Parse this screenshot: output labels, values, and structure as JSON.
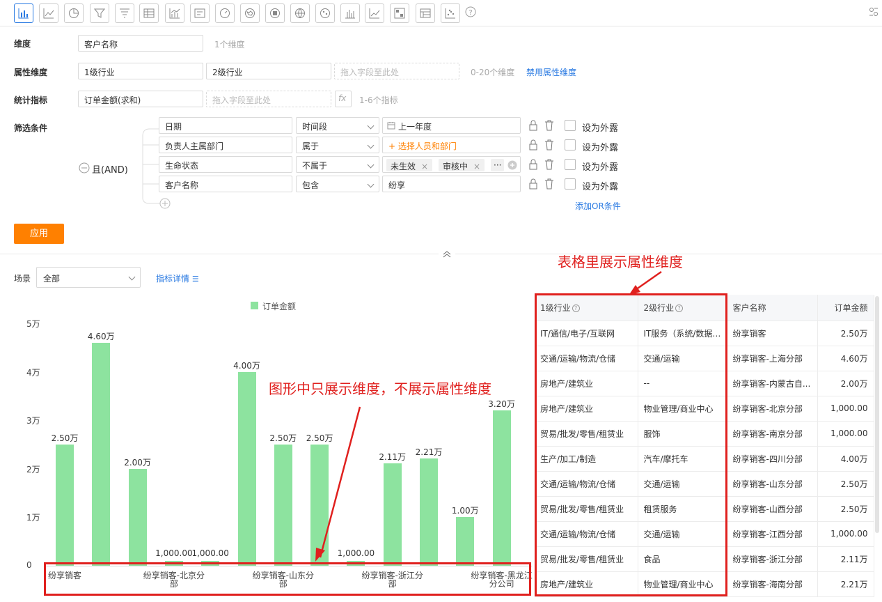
{
  "form": {
    "dimension_label": "维度",
    "dimension_value": "客户名称",
    "dimension_hint": "1个维度",
    "attr_label": "属性维度",
    "attr_values": [
      "1级行业",
      "2级行业"
    ],
    "drop_placeholder": "拖入字段至此处",
    "attr_hint": "0-20个维度",
    "disable_attr_link": "禁用属性维度",
    "metric_label": "统计指标",
    "metric_value": "订单金额(求和)",
    "fx_label": "fx",
    "metric_hint": "1-6个指标",
    "filter_label": "筛选条件",
    "and_label": "且(AND)",
    "filters": [
      {
        "field": "日期",
        "op": "时间段",
        "value": "上一年度"
      },
      {
        "field": "负责人主属部门",
        "op": "属于",
        "value": "+ 选择人员和部门"
      },
      {
        "field": "生命状态",
        "op": "不属于",
        "tags": [
          "未生效",
          "审核中"
        ],
        "more": "···"
      },
      {
        "field": "客户名称",
        "op": "包含",
        "value": "纷享"
      }
    ],
    "expose_label": "设为外露",
    "add_or_link": "添加OR条件",
    "apply_button": "应用"
  },
  "scene": {
    "label": "场景",
    "value": "全部",
    "detail_link": "指标详情"
  },
  "chart_data": {
    "type": "bar",
    "legend": [
      "订单金额"
    ],
    "y_ticks": [
      "5万",
      "4万",
      "3万",
      "2万",
      "1万",
      "0"
    ],
    "ylim": [
      0,
      50000
    ],
    "values": [
      25000,
      46000,
      20000,
      1000,
      1000,
      40000,
      25000,
      25000,
      1000,
      21100,
      22100,
      10000,
      32000
    ],
    "data_labels": [
      "2.50万",
      "4.60万",
      "2.00万",
      "1,000.00",
      "1,000.00",
      "4.00万",
      "2.50万",
      "2.50万",
      "1,000.00",
      "2.11万",
      "2.21万",
      "1.00万",
      "3.20万"
    ],
    "x_tick_labels": [
      {
        "index": 0,
        "lines": [
          "纷享销客"
        ]
      },
      {
        "index": 3,
        "lines": [
          "纷享销客-北京分",
          "部"
        ]
      },
      {
        "index": 6,
        "lines": [
          "纷享销客-山东分",
          "部"
        ]
      },
      {
        "index": 9,
        "lines": [
          "纷享销客-浙江分",
          "部"
        ]
      },
      {
        "index": 12,
        "lines": [
          "纷享销客-黑龙江",
          "分公司"
        ]
      }
    ],
    "color": "#8de39f"
  },
  "annotations": {
    "table_note": "表格里展示属性维度",
    "chart_note": "图形中只展示维度，不展示属性维度",
    "color": "#e0201e"
  },
  "table": {
    "headers": [
      "1级行业",
      "2级行业",
      "客户名称",
      "订单金额"
    ],
    "rows": [
      [
        "IT/通信/电子/互联网",
        "IT服务（系统/数据/...",
        "纷享销客",
        "2.50万"
      ],
      [
        "交通/运输/物流/仓储",
        "交通/运输",
        "纷享销客-上海分部",
        "4.60万"
      ],
      [
        "房地产/建筑业",
        "--",
        "纷享销客-内蒙古自...",
        "2.00万"
      ],
      [
        "房地产/建筑业",
        "物业管理/商业中心",
        "纷享销客-北京分部",
        "1,000.00"
      ],
      [
        "贸易/批发/零售/租赁业",
        "服饰",
        "纷享销客-南京分部",
        "1,000.00"
      ],
      [
        "生产/加工/制造",
        "汽车/摩托车",
        "纷享销客-四川分部",
        "4.00万"
      ],
      [
        "交通/运输/物流/仓储",
        "交通/运输",
        "纷享销客-山东分部",
        "2.50万"
      ],
      [
        "贸易/批发/零售/租赁业",
        "租赁服务",
        "纷享销客-山西分部",
        "2.50万"
      ],
      [
        "交通/运输/物流/仓储",
        "交通/运输",
        "纷享销客-江西分部",
        "1,000.00"
      ],
      [
        "贸易/批发/零售/租赁业",
        "食品",
        "纷享销客-浙江分部",
        "2.11万"
      ],
      [
        "房地产/建筑业",
        "物业管理/商业中心",
        "纷享销客-海南分部",
        "2.21万"
      ]
    ]
  }
}
